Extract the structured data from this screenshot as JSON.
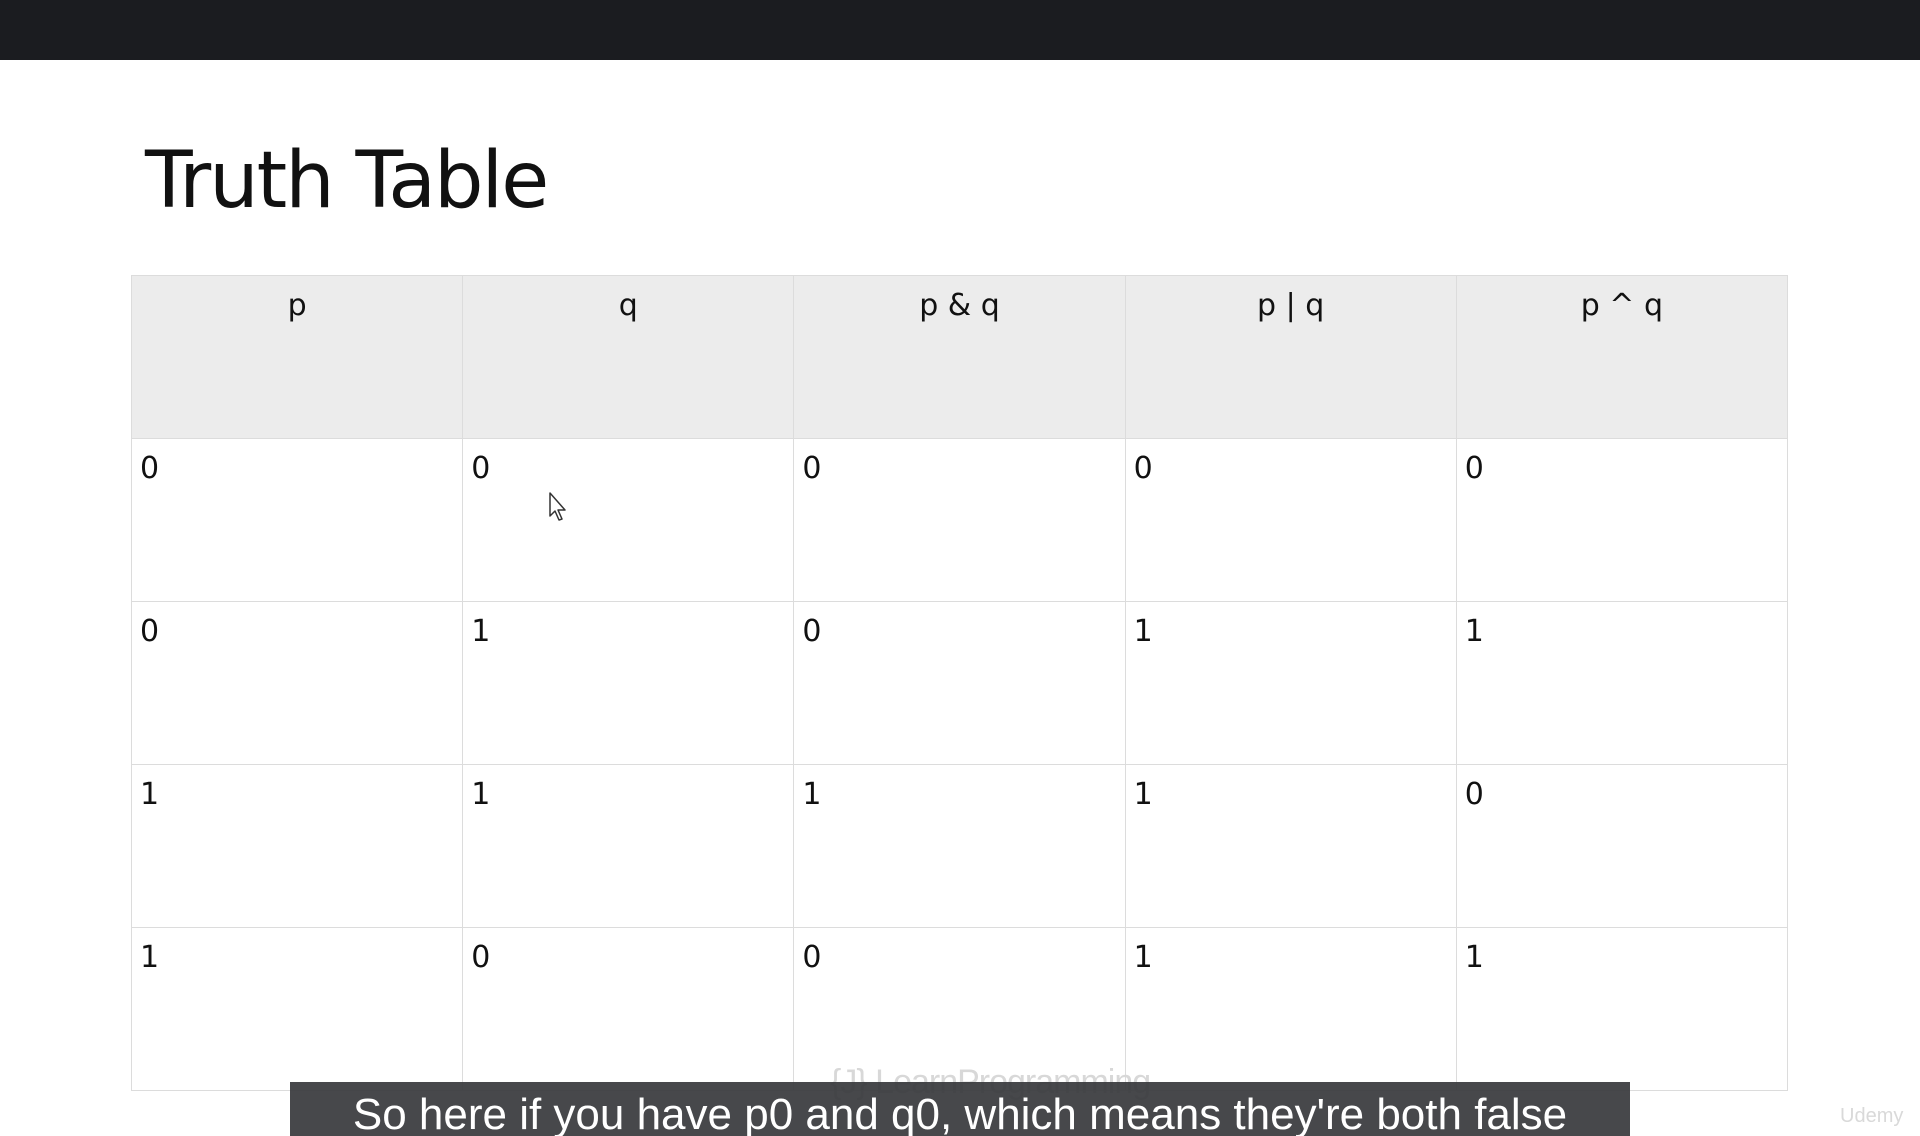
{
  "slide": {
    "title": "Truth Table"
  },
  "table": {
    "headers": [
      "p",
      "q",
      "p & q",
      "p | q",
      "p ^ q"
    ],
    "rows": [
      [
        "0",
        "0",
        "0",
        "0",
        "0"
      ],
      [
        "0",
        "1",
        "0",
        "1",
        "1"
      ],
      [
        "1",
        "1",
        "1",
        "1",
        "0"
      ],
      [
        "1",
        "0",
        "0",
        "1",
        "1"
      ]
    ]
  },
  "watermark": {
    "text": "{J} LearnProgramming"
  },
  "caption": {
    "text": "So here if you have p0 and q0, which means they're both false"
  },
  "branding": {
    "udemy_label": "Udemy"
  },
  "cursor": {
    "icon": "mouse-pointer-icon"
  }
}
